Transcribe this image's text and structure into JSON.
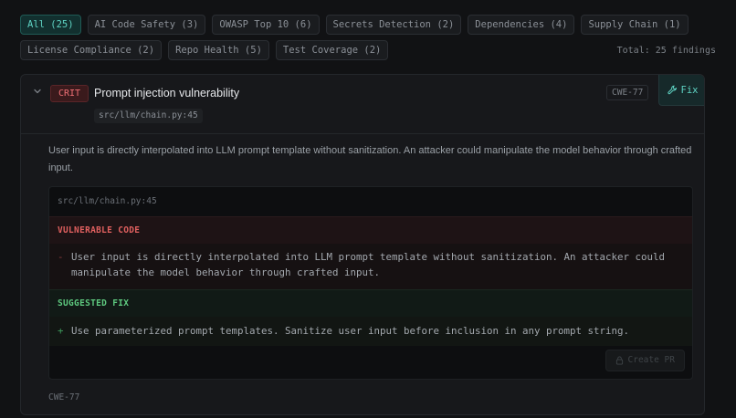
{
  "filters": {
    "row1": [
      "All (25)",
      "AI Code Safety (3)",
      "OWASP Top 10 (6)",
      "Secrets Detection (2)",
      "Dependencies (4)",
      "Supply Chain (1)"
    ],
    "row2": [
      "License Compliance (2)",
      "Repo Health (5)",
      "Test Coverage (2)"
    ],
    "active": "All (25)",
    "total": "Total: 25 findings"
  },
  "finding": {
    "severity": "CRIT",
    "title": "Prompt injection vulnerability",
    "location": "src/llm/chain.py:45",
    "cwe": "CWE-77",
    "fix_label": "Fix",
    "description": "User input is directly interpolated into LLM prompt template without sanitization. An attacker could manipulate the model behavior through crafted input.",
    "code": {
      "file": "src/llm/chain.py:45",
      "vulnerable_label": "VULNERABLE CODE",
      "vulnerable_prefix": "-",
      "vulnerable_text": "User input is directly interpolated into LLM prompt template without sanitization. An attacker could manipulate the model behavior through crafted input.",
      "fix_section_label": "SUGGESTED FIX",
      "fix_prefix": "+",
      "fix_text": "Use parameterized prompt templates. Sanitize user input before inclusion in any prompt string.",
      "create_pr_label": "Create PR"
    },
    "cwe_footer": "CWE-77"
  },
  "colors": {
    "accent": "#5fd4c4",
    "critical": "#f07075",
    "vulnerable": "#e0605f",
    "fix": "#5ec97f"
  },
  "icons": {
    "expand": "chevron-down-icon",
    "fix": "wrench-icon",
    "pr": "lock-icon"
  }
}
